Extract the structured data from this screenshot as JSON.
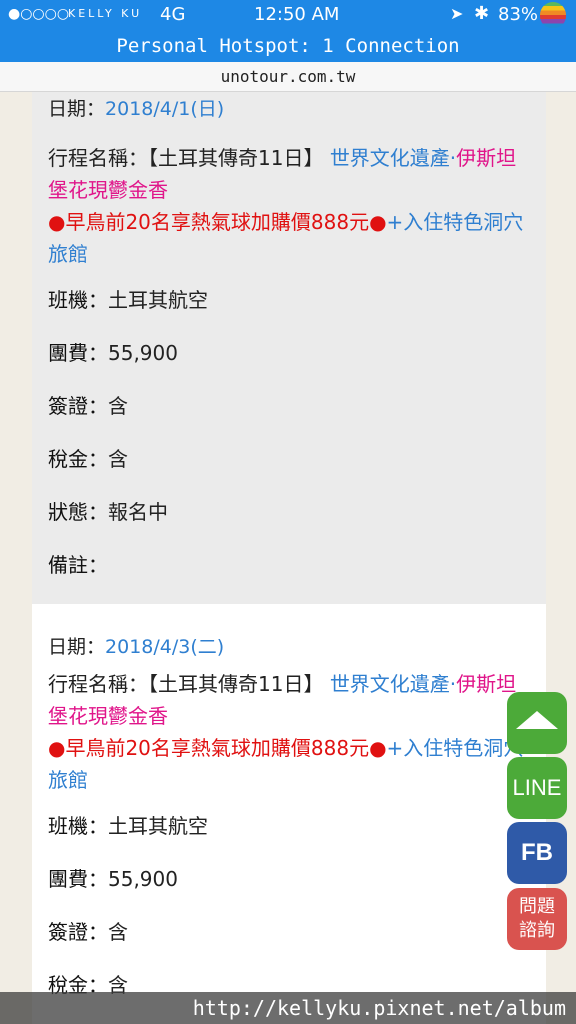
{
  "status_bar": {
    "signal": "●○○○○",
    "carrier": "KELLY KU",
    "network": "4G",
    "time": "12:50 AM",
    "battery": "83%"
  },
  "hotspot_banner": "Personal Hotspot: 1 Connection",
  "url": "unotour.com.tw",
  "colors": {
    "status_bar": "#1e88e5",
    "blue_text": "#2f7fd0",
    "pink_text": "#e0158a",
    "red_text": "#e01111",
    "green_button": "#4caa39",
    "fb_button": "#2f5aa8",
    "red_button": "#d9534f"
  },
  "entries": [
    {
      "date_label": "日期：",
      "date_value": "2018/4/1(日)",
      "trip_label": "行程名稱：",
      "trip_title": "【土耳其傳奇11日】",
      "trip_blue": "世界文化遺產·",
      "trip_pink": "伊斯坦堡花現鬱金香",
      "trip_red": "●早鳥前20名享熱氣球加購價888元●",
      "trip_blue2": "+入住特色洞穴旅館",
      "airline_label": "班機：",
      "airline_value": "土耳其航空",
      "fee_label": "團費：",
      "fee_value": "55,900",
      "visa_label": "簽證：",
      "visa_value": "含",
      "tax_label": "稅金：",
      "tax_value": "含",
      "status_label": "狀態：",
      "status_value": "報名中",
      "note_label": "備註："
    },
    {
      "date_label": "日期：",
      "date_value": "2018/4/3(二)",
      "trip_label": "行程名稱：",
      "trip_title": "【土耳其傳奇11日】",
      "trip_blue": "世界文化遺產·",
      "trip_pink": "伊斯坦堡花現鬱金香",
      "trip_red": "●早鳥前20名享熱氣球加購價888元●",
      "trip_blue2": "+入住特色洞穴旅館",
      "airline_label": "班機：",
      "airline_value": "土耳其航空",
      "fee_label": "團費：",
      "fee_value": "55,900",
      "visa_label": "簽證：",
      "visa_value": "含",
      "tax_label": "稅金：",
      "tax_value": "含"
    }
  ],
  "floating": {
    "top_icon": "up-triangle-icon",
    "line": "LINE",
    "fb": "FB",
    "ask_line1": "問題",
    "ask_line2": "諮詢"
  },
  "watermark": "http://kellyku.pixnet.net/album"
}
